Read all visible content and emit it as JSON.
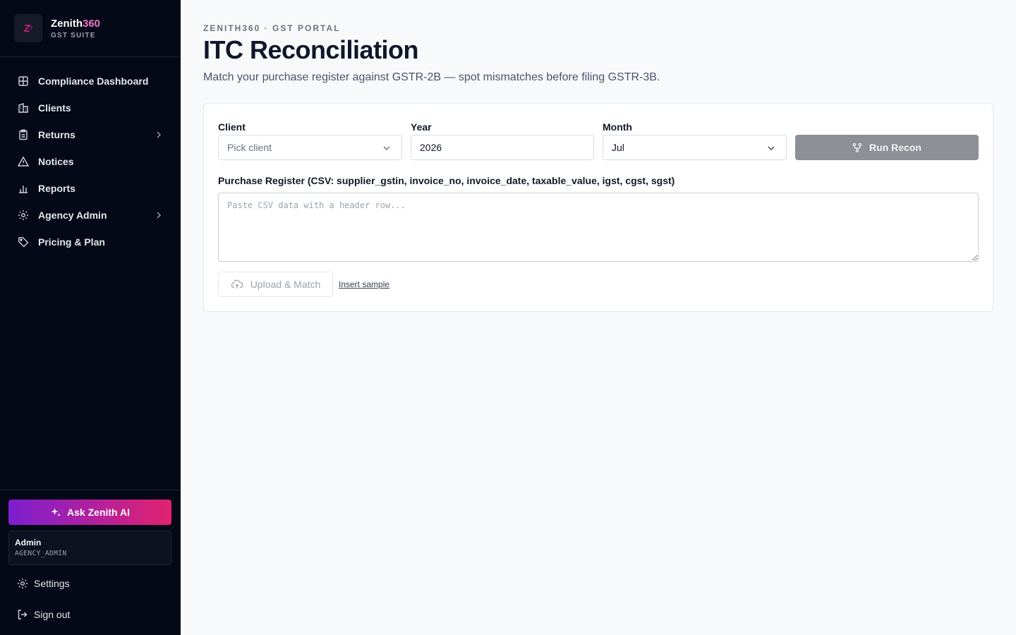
{
  "brand": {
    "name_main": "Zenith",
    "name_accent": "360",
    "subtitle": "GST SUITE"
  },
  "sidebar": {
    "items": [
      {
        "label": "Compliance Dashboard",
        "icon": "grid-icon"
      },
      {
        "label": "Clients",
        "icon": "building-icon"
      },
      {
        "label": "Returns",
        "icon": "clipboard-icon",
        "has_submenu": true
      },
      {
        "label": "Notices",
        "icon": "warning-icon"
      },
      {
        "label": "Reports",
        "icon": "bar-chart-icon"
      },
      {
        "label": "Agency Admin",
        "icon": "gear-icon",
        "has_submenu": true
      },
      {
        "label": "Pricing & Plan",
        "icon": "tag-icon"
      }
    ],
    "ai_button": "Ask Zenith AI",
    "user": {
      "name": "Admin",
      "role": "AGENCY_ADMIN"
    },
    "settings_label": "Settings",
    "signout_label": "Sign out"
  },
  "header": {
    "eyebrow": "ZENITH360 · GST PORTAL",
    "title": "ITC Reconciliation",
    "subtitle": "Match your purchase register against GSTR-2B — spot mismatches before filing GSTR-3B."
  },
  "form": {
    "client": {
      "label": "Client",
      "placeholder": "Pick client"
    },
    "year": {
      "label": "Year",
      "value": "2026"
    },
    "month": {
      "label": "Month",
      "value": "Jul"
    },
    "run_button": "Run Recon",
    "csv": {
      "label": "Purchase Register (CSV: supplier_gstin, invoice_no, invoice_date, taxable_value, igst, cgst, sgst)",
      "placeholder": "Paste CSV data with a header row...",
      "value": ""
    },
    "upload_button": "Upload & Match",
    "insert_sample": "Insert sample"
  },
  "colors": {
    "sidebar_bg": "#050817",
    "accent": "#e879c9",
    "ai_gradient_start": "#7c1fd0",
    "ai_gradient_end": "#e2226f",
    "disabled_button": "#8c9096"
  }
}
